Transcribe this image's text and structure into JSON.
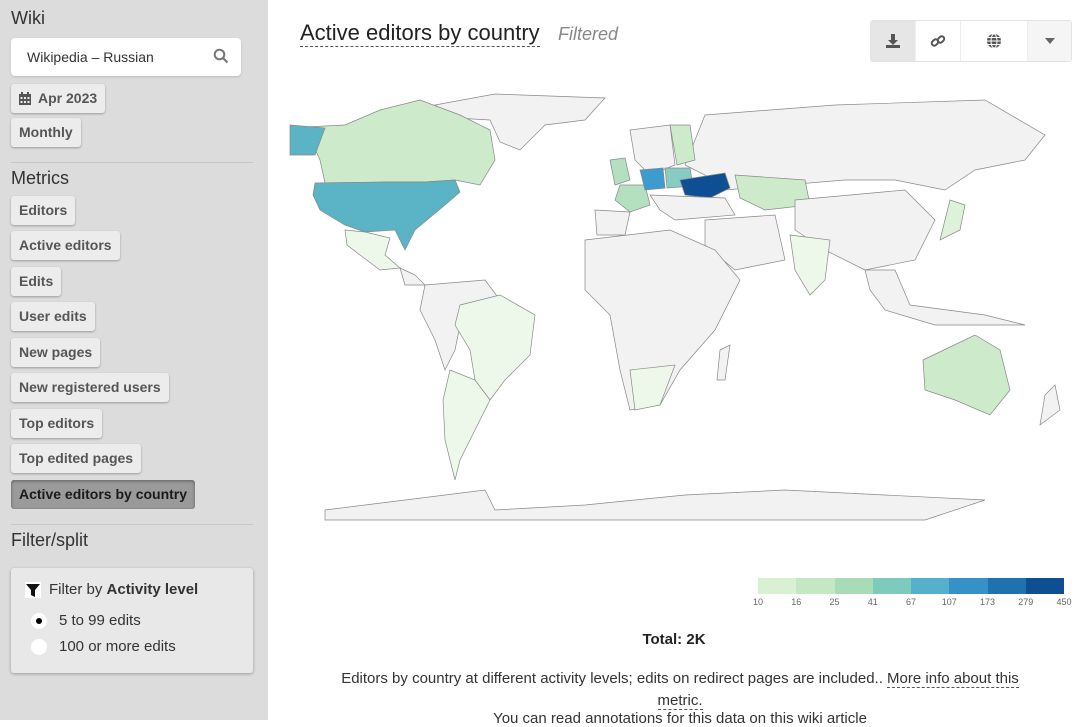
{
  "sidebar": {
    "wiki_heading": "Wiki",
    "wiki_search_value": "Wikipedia – Russian",
    "date_button": "Apr 2023",
    "granularity_button": "Monthly",
    "metrics_heading": "Metrics",
    "metrics": [
      {
        "label": "Editors",
        "active": false
      },
      {
        "label": "Active editors",
        "active": false
      },
      {
        "label": "Edits",
        "active": false
      },
      {
        "label": "User edits",
        "active": false
      },
      {
        "label": "New pages",
        "active": false
      },
      {
        "label": "New registered users",
        "active": false
      },
      {
        "label": "Top editors",
        "active": false
      },
      {
        "label": "Top edited pages",
        "active": false
      },
      {
        "label": "Active editors by country",
        "active": true
      }
    ],
    "filter_heading": "Filter/split",
    "filter": {
      "title_prefix": "Filter by",
      "title_bold": "Activity level",
      "options": [
        {
          "label": "5 to 99 edits",
          "selected": true
        },
        {
          "label": "100 or more edits",
          "selected": false
        }
      ]
    }
  },
  "main": {
    "title": "Active editors by country",
    "subtitle": "Filtered",
    "toolbar": [
      "download-icon",
      "link-icon",
      "globe-icon",
      "caret-down-icon"
    ],
    "total": "Total: 2K",
    "description": "Editors by country at different activity levels; edits on redirect pages are included..",
    "more_info_link": "More info about this metric.",
    "cut_line": "You can read annotations for this data on this wiki article"
  },
  "chart_data": {
    "type": "heatmap",
    "subtype": "choropleth-world-map",
    "title": "Active editors by country",
    "legend": {
      "placement": "bottom-right",
      "thresholds": [
        10,
        16,
        25,
        41,
        67,
        107,
        173,
        279,
        450
      ],
      "colors": [
        "#d9f0d3",
        "#c4e8c4",
        "#a8dcb8",
        "#7ecbbe",
        "#55b0cc",
        "#3591c6",
        "#1e72b0",
        "#0d4f92",
        "#08306b"
      ]
    },
    "regions": [
      {
        "name": "Ukraine",
        "bucket": "279-450",
        "color": "#0d4f92"
      },
      {
        "name": "Germany",
        "bucket": "107-173",
        "color": "#3d9bd0"
      },
      {
        "name": "United States",
        "bucket": "67-107",
        "color": "#5ab4c6"
      },
      {
        "name": "Alaska (US)",
        "bucket": "67-107",
        "color": "#5ab4c6"
      },
      {
        "name": "Poland",
        "bucket": "41-67",
        "color": "#86ccc4"
      },
      {
        "name": "Canada",
        "bucket": "16-25",
        "color": "#cdeacb"
      },
      {
        "name": "France",
        "bucket": "25-41",
        "color": "#b5e0bf"
      },
      {
        "name": "United Kingdom",
        "bucket": "25-41",
        "color": "#b5e0bf"
      },
      {
        "name": "Finland",
        "bucket": "16-25",
        "color": "#cdeacb"
      },
      {
        "name": "Kazakhstan",
        "bucket": "16-25",
        "color": "#cdeacb"
      },
      {
        "name": "Australia",
        "bucket": "16-25",
        "color": "#cdeacb"
      },
      {
        "name": "Japan",
        "bucket": "10-16",
        "color": "#def2d9"
      },
      {
        "name": "Brazil",
        "bucket": "<10",
        "color": "#eef8ea"
      },
      {
        "name": "Argentina",
        "bucket": "<10",
        "color": "#eef8ea"
      },
      {
        "name": "India",
        "bucket": "<10",
        "color": "#eef8ea"
      },
      {
        "name": "Mexico",
        "bucket": "<10",
        "color": "#eef8ea"
      },
      {
        "name": "South Africa",
        "bucket": "<10",
        "color": "#eef8ea"
      },
      {
        "name": "Russia",
        "bucket": "no data",
        "color": "#f2f2f2"
      }
    ],
    "total": "2K"
  }
}
